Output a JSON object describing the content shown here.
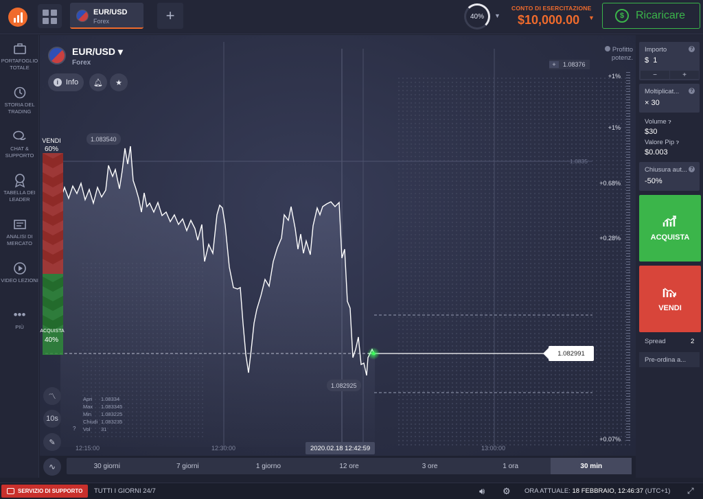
{
  "topbar": {
    "asset_tab": {
      "name": "EUR/USD",
      "type": "Forex"
    },
    "ring_percent": "40%",
    "account_label": "CONTO DI ESERCITAZIONE",
    "balance": "$10,000.00",
    "recharge_label": "Ricaricare"
  },
  "sidebar": {
    "items": [
      {
        "icon": "briefcase-icon",
        "label": "PORTAFOGLIO TOTALE"
      },
      {
        "icon": "history-icon",
        "label": "STORIA DEL TRADING"
      },
      {
        "icon": "chat-icon",
        "label": "CHAT & SUPPORTO"
      },
      {
        "icon": "medal-icon",
        "label": "TABELLA DEI LEADER"
      },
      {
        "icon": "news-icon",
        "label": "ANALISI DI MERCATO"
      },
      {
        "icon": "play-icon",
        "label": "VIDEO LEZIONI"
      },
      {
        "icon": "more-icon",
        "label": "PIÙ"
      }
    ]
  },
  "chart": {
    "title": "EUR/USD",
    "subtitle": "Forex",
    "info_label": "Info",
    "sell_label": "VENDI",
    "sell_pct": "60%",
    "buy_label": "ACQUISTA",
    "buy_pct": "40%",
    "timer_label": "10s",
    "high_tag": "1.083540",
    "low_tag": "1.082925",
    "current_price": "1.082991",
    "level_label": "1.0835",
    "top_price": "1.08376",
    "top_price_plus": "+",
    "profit_label": "Profitto potenz.",
    "percent_levels": [
      "+1%",
      "+1%",
      "+0.68%",
      "+0.28%",
      "+0.07%"
    ],
    "ohlc": {
      "rows": [
        {
          "k": "Apri",
          "v": "1.08334"
        },
        {
          "k": "Max",
          "v": "1.083345"
        },
        {
          "k": "Min",
          "v": "1.083225"
        },
        {
          "k": "Chiudi",
          "v": "1.083235"
        },
        {
          "k": "Vol",
          "v": "31"
        }
      ]
    },
    "x_labels": [
      "12:15:00",
      "12:30:00",
      "13:00:00"
    ],
    "time_cursor": "2020.02.18 12:42:59"
  },
  "timeframes": [
    "30 giorni",
    "7 giorni",
    "1 giorno",
    "12 ore",
    "3 ore",
    "1 ora",
    "30 min"
  ],
  "active_timeframe": "30 min",
  "panel": {
    "amount_label": "Importo",
    "amount_value": "1",
    "currency": "$",
    "minus": "−",
    "plus": "+",
    "multiplier_label": "Moltiplicat...",
    "multiplier_value": "× 30",
    "volume_label": "Volume",
    "volume_value": "$30",
    "pip_label": "Valore Pip",
    "pip_value": "$0.003",
    "close_label": "Chiusura aut...",
    "close_value": "-50%",
    "buy_label": "ACQUISTA",
    "sell_label": "VENDI",
    "spread_label": "Spread",
    "spread_value": "2",
    "preorder_label": "Pre-ordina a..."
  },
  "statusbar": {
    "support_label": "SERVIZIO DI SUPPORTO",
    "schedule": "TUTTI I GIORNI 24/7",
    "time_label": "ORA ATTUALE:",
    "time_value": "18 FEBBRAIO, 12:46:37",
    "timezone": "(UTC+1)"
  },
  "colors": {
    "accent": "#f06b2c",
    "buy": "#3bb54a",
    "sell": "#d8453a",
    "background": "#1f2231"
  }
}
